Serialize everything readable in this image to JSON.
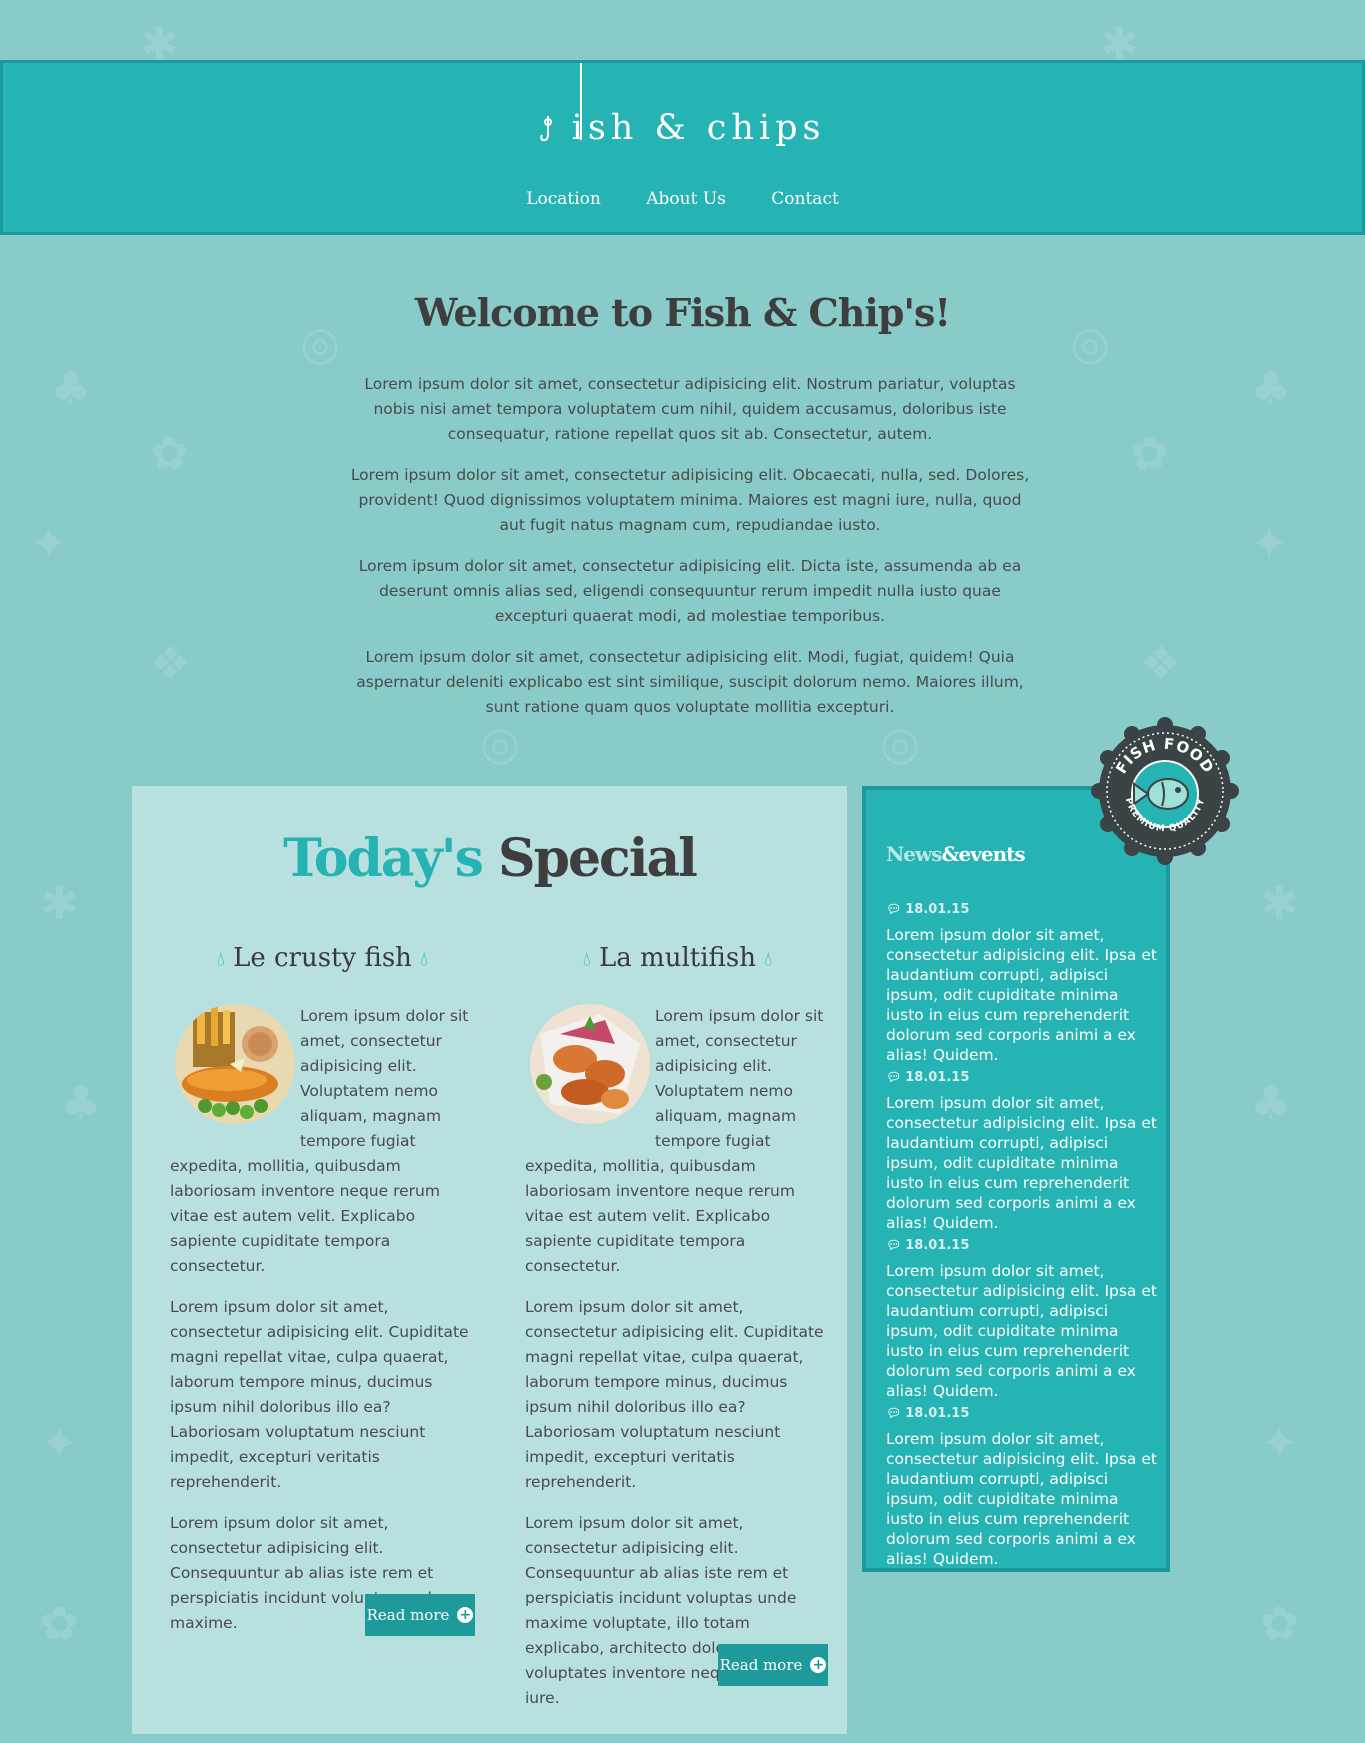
{
  "header": {
    "logo_text": "ish & chips",
    "nav": [
      "Location",
      "About Us",
      "Contact"
    ]
  },
  "intro": {
    "title": "Welcome to Fish & Chip's!",
    "paragraphs": [
      "Lorem ipsum dolor sit amet, consectetur adipisicing elit. Nostrum pariatur, voluptas nobis nisi amet tempora voluptatem cum nihil, quidem accusamus, doloribus iste consequatur, ratione repellat quos sit ab. Consectetur, autem.",
      "Lorem ipsum dolor sit amet, consectetur adipisicing elit. Obcaecati, nulla, sed. Dolores, provident! Quod dignissimos voluptatem minima. Maiores est magni iure, nulla, quod aut fugit natus magnam cum, repudiandae iusto.",
      "Lorem ipsum dolor sit amet, consectetur adipisicing elit. Dicta iste, assumenda ab ea deserunt omnis alias sed, eligendi consequuntur rerum impedit nulla iusto quae excepturi quaerat modi, ad molestiae temporibus.",
      "Lorem ipsum dolor sit amet, consectetur adipisicing elit. Modi, fugiat, quidem! Quia aspernatur deleniti explicabo est sint similique, suscipit dolorum nemo. Maiores illum, sunt ratione quam quos voluptate mollitia excepturi."
    ]
  },
  "specials": {
    "title_accent": "Today's",
    "title_rest": " Special",
    "items": [
      {
        "name": "Le crusty fish",
        "paragraphs": [
          "Lorem ipsum dolor sit amet, consectetur adipisicing elit. Voluptatem nemo aliquam, magnam tempore fugiat expedita, mollitia, quibusdam laboriosam inventore neque rerum vitae est autem velit. Explicabo sapiente cupiditate tempora consectetur.",
          "Lorem ipsum dolor sit amet, consectetur adipisicing elit. Cupiditate magni repellat vitae, culpa quaerat, laborum tempore minus, ducimus ipsum nihil doloribus illo ea? Laboriosam voluptatum nesciunt impedit, excepturi veritatis reprehenderit.",
          "Lorem ipsum dolor sit amet, consectetur adipisicing elit. Consequuntur ab alias iste rem et perspiciatis incidunt voluptas unde maxime."
        ],
        "button": "Read more"
      },
      {
        "name": "La multifish",
        "paragraphs": [
          "Lorem ipsum dolor sit amet, consectetur adipisicing elit. Voluptatem nemo aliquam, magnam tempore fugiat expedita, mollitia, quibusdam laboriosam inventore neque rerum vitae est autem velit. Explicabo sapiente cupiditate tempora consectetur.",
          "Lorem ipsum dolor sit amet, consectetur adipisicing elit. Cupiditate magni repellat vitae, culpa quaerat, laborum tempore minus, ducimus ipsum nihil doloribus illo ea? Laboriosam voluptatum nesciunt impedit, excepturi veritatis reprehenderit.",
          "Lorem ipsum dolor sit amet, consectetur adipisicing elit. Consequuntur ab alias iste rem et perspiciatis incidunt voluptas unde maxime voluptate, illo totam explicabo, architecto dolorem, voluptates inventore neque tenetur iure."
        ],
        "button": "Read more"
      }
    ]
  },
  "news": {
    "title_light": "News",
    "title_bold": "&events",
    "items": [
      {
        "date": "18.01.15",
        "text": "Lorem ipsum dolor sit amet, consectetur adipisicing elit. Ipsa et laudantium corrupti, adipisci ipsum, odit cupiditate minima iusto in eius cum reprehenderit dolorum sed corporis animi a ex alias! Quidem."
      },
      {
        "date": "18.01.15",
        "text": "Lorem ipsum dolor sit amet, consectetur adipisicing elit. Ipsa et laudantium corrupti, adipisci ipsum, odit cupiditate minima iusto in eius cum reprehenderit dolorum sed corporis animi a ex alias! Quidem."
      },
      {
        "date": "18.01.15",
        "text": "Lorem ipsum dolor sit amet, consectetur adipisicing elit. Ipsa et laudantium corrupti, adipisci ipsum, odit cupiditate minima iusto in eius cum reprehenderit dolorum sed corporis animi a ex alias! Quidem."
      },
      {
        "date": "18.01.15",
        "text": "Lorem ipsum dolor sit amet, consectetur adipisicing elit. Ipsa et laudantium corrupti, adipisci ipsum, odit cupiditate minima iusto in eius cum reprehenderit dolorum sed corporis animi a ex alias! Quidem."
      }
    ]
  },
  "badge": {
    "top_text": "FISH FOOD",
    "bottom_text": "PREMIUM QUALITY"
  },
  "icons": {
    "hook": "hook-icon",
    "drop": "water-drop-icon",
    "comment": "comment-bubble-icon",
    "plus": "plus-circle-icon",
    "fish": "fish-icon"
  },
  "colors": {
    "background": "#89cbc8",
    "header": "#25b3b3",
    "accent": "#25b3b3",
    "panel": "#b8e0df",
    "button": "#1e9a9b",
    "badge_dark": "#3a4345"
  }
}
